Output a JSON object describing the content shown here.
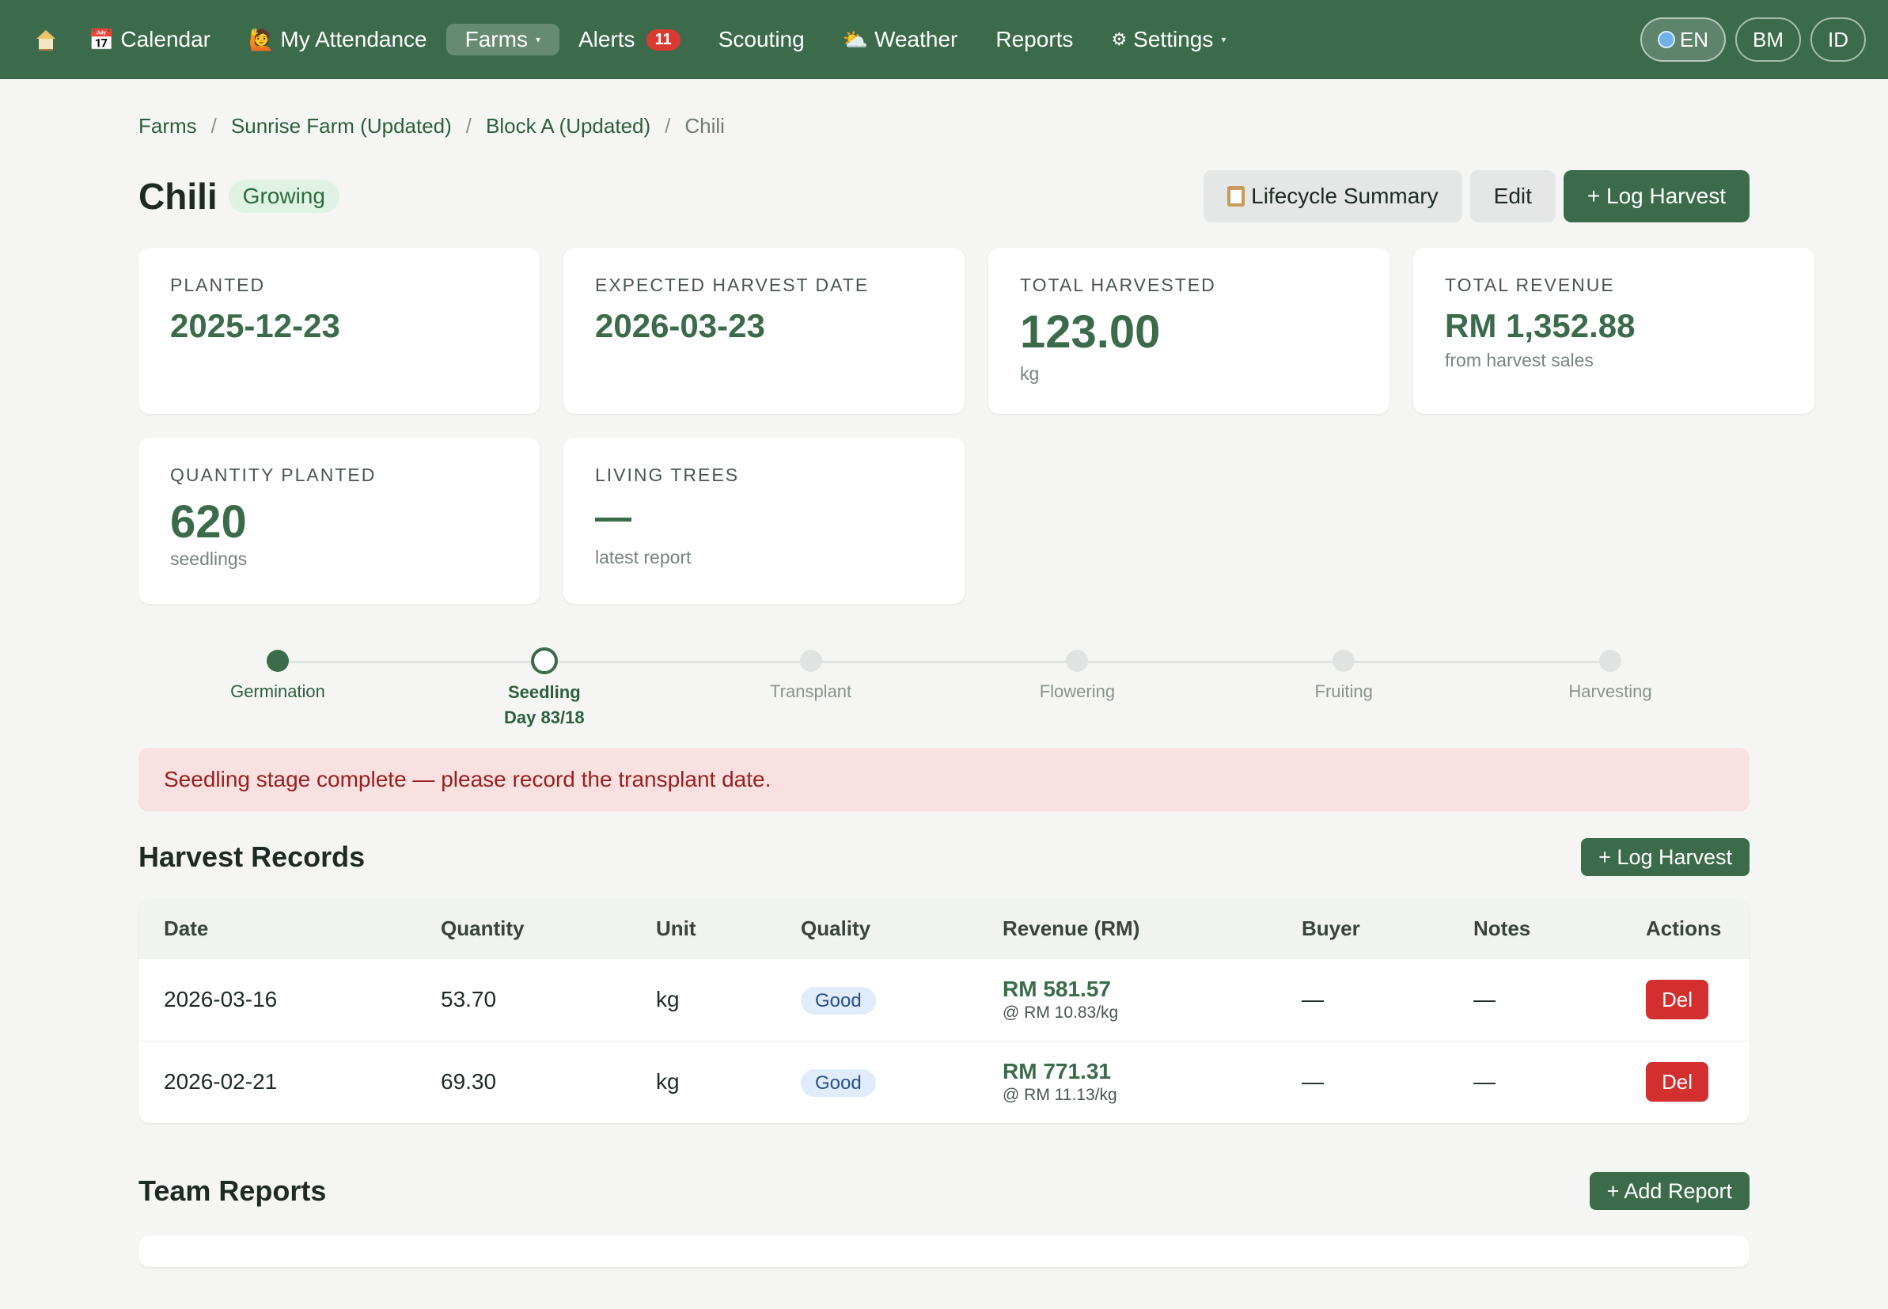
{
  "nav": {
    "home_icon": "home-icon",
    "items": [
      {
        "label": "Calendar",
        "icon": "📅"
      },
      {
        "label": "My Attendance",
        "icon": "🙋"
      },
      {
        "label": "Farms"
      },
      {
        "label": "Alerts",
        "badge": "11"
      },
      {
        "label": "Scouting"
      },
      {
        "label": "Weather",
        "icon": "⛅"
      },
      {
        "label": "Reports"
      },
      {
        "label": "Settings",
        "icon": "⚙"
      }
    ],
    "languages": [
      "EN",
      "BM",
      "ID"
    ]
  },
  "breadcrumb": [
    "Farms",
    "Sunrise Farm (Updated)",
    "Block A (Updated)",
    "Chili"
  ],
  "page": {
    "title": "Chili",
    "status": "Growing",
    "buttons": {
      "lifecycle": "Lifecycle Summary",
      "edit": "Edit",
      "log_harvest": "+ Log Harvest"
    }
  },
  "stats": [
    {
      "label": "Planted",
      "value": "2025-12-23",
      "sub": ""
    },
    {
      "label": "Expected Harvest Date",
      "value": "2026-03-23",
      "sub": ""
    },
    {
      "label": "Total Harvested",
      "value": "123.00",
      "sub": "kg"
    },
    {
      "label": "Total Revenue",
      "value": "RM 1,352.88",
      "sub": "from harvest sales"
    },
    {
      "label": "Quantity Planted",
      "value": "620",
      "sub": "seedlings"
    },
    {
      "label": "Living Trees",
      "value": "",
      "sub": "latest report"
    }
  ],
  "stages": [
    {
      "label": "Germination",
      "state": "done"
    },
    {
      "label": "Seedling",
      "state": "current",
      "day": "Day 83/18"
    },
    {
      "label": "Transplant",
      "state": "pending"
    },
    {
      "label": "Flowering",
      "state": "pending"
    },
    {
      "label": "Fruiting",
      "state": "pending"
    },
    {
      "label": "Harvesting",
      "state": "pending"
    }
  ],
  "alert": "Seedling stage complete — please record the transplant date.",
  "harvest": {
    "title": "Harvest Records",
    "add_label": "+ Log Harvest",
    "columns": [
      "Date",
      "Quantity",
      "Unit",
      "Quality",
      "Revenue (RM)",
      "Buyer",
      "Notes",
      "Actions"
    ],
    "rows": [
      {
        "date": "2026-03-16",
        "quantity": "53.70",
        "unit": "kg",
        "quality": "Good",
        "revenue": "RM 581.57",
        "rate": "@ RM 10.83/kg",
        "buyer": "—",
        "notes": "—",
        "action": "Del"
      },
      {
        "date": "2026-02-21",
        "quantity": "69.30",
        "unit": "kg",
        "quality": "Good",
        "revenue": "RM 771.31",
        "rate": "@ RM 11.13/kg",
        "buyer": "—",
        "notes": "—",
        "action": "Del"
      }
    ]
  },
  "team_reports": {
    "title": "Team Reports",
    "add_label": "+ Add Report"
  }
}
